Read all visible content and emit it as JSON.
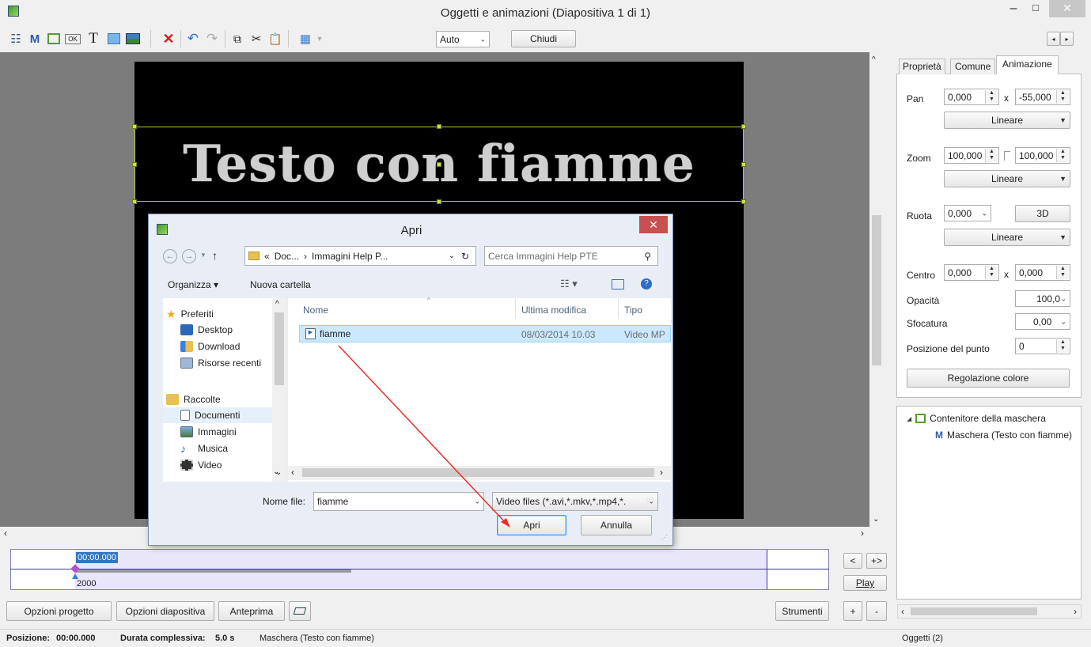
{
  "window": {
    "title": "Oggetti e animazioni  (Diapositiva 1 di 1)"
  },
  "toolbar": {
    "zoom_value": "Auto",
    "close_label": "Chiudi",
    "text_tool": "T",
    "mask_tool": "M",
    "ok_tool": "OK"
  },
  "canvas": {
    "text": "Testo con fiamme"
  },
  "tabs": [
    "Proprietà",
    "Comune",
    "Animazione"
  ],
  "props": {
    "pan_label": "Pan",
    "pan_x": "0,000",
    "pan_y": "-55,000",
    "x_sep": "x",
    "pan_mode": "Lineare",
    "zoom_label": "Zoom",
    "zoom_x": "100,000",
    "zoom_y": "100,000",
    "zoom_mode": "Lineare",
    "rotate_label": "Ruota",
    "rotate_value": "0,000",
    "rotate_3d": "3D",
    "rotate_mode": "Lineare",
    "center_label": "Centro",
    "center_x": "0,000",
    "center_y": "0,000",
    "opacity_label": "Opacità",
    "opacity_value": "100,0",
    "blur_label": "Sfocatura",
    "blur_value": "0,00",
    "point_label": "Posizione del punto",
    "point_value": "0",
    "color_button": "Regolazione colore"
  },
  "tree": {
    "container": "Contenitore della maschera",
    "mask": "Maschera (Testo con fiamme)",
    "mask_icon": "M"
  },
  "timeline": {
    "time": "00:00.000",
    "value": "2000",
    "prev": "<",
    "next": "+>",
    "play": "Play"
  },
  "bottom_buttons": {
    "project": "Opzioni progetto",
    "slide": "Opzioni diapositiva",
    "preview": "Anteprima",
    "tools": "Strumenti",
    "plus": "+",
    "minus": "-"
  },
  "status": {
    "position_label": "Posizione:",
    "position_value": "00:00.000",
    "duration_label": "Durata complessiva:",
    "duration_value": "5.0 s",
    "selected": "Maschera (Testo con fiamme)",
    "objects": "Oggetti (2)"
  },
  "dialog": {
    "title": "Apri",
    "path_prefix": "«",
    "path_1": "Doc...",
    "path_sep": "›",
    "path_2": "Immagini Help P...",
    "search_placeholder": "Cerca Immagini Help PTE",
    "organize": "Organizza ▾",
    "new_folder": "Nuova cartella",
    "nav": {
      "favorites": "Preferiti",
      "desktop": "Desktop",
      "download": "Download",
      "recent": "Risorse recenti",
      "libraries": "Raccolte",
      "documents": "Documenti",
      "images": "Immagini",
      "music": "Musica",
      "video": "Video"
    },
    "columns": {
      "name": "Nome",
      "modified": "Ultima modifica",
      "type": "Tipo"
    },
    "file": {
      "name": "fiamme",
      "modified": "08/03/2014 10.03",
      "type": "Video MP"
    },
    "filename_label": "Nome file:",
    "filename_value": "fiamme",
    "filter": "Video files (*.avi,*.mkv,*.mp4,*.",
    "open": "Apri",
    "cancel": "Annulla"
  },
  "colors": {
    "accent": "#3399ff",
    "selection": "#cce8ff",
    "close_red": "#c75050",
    "timeline_bg": "#e8e6f8",
    "handle": "#c8e046"
  }
}
